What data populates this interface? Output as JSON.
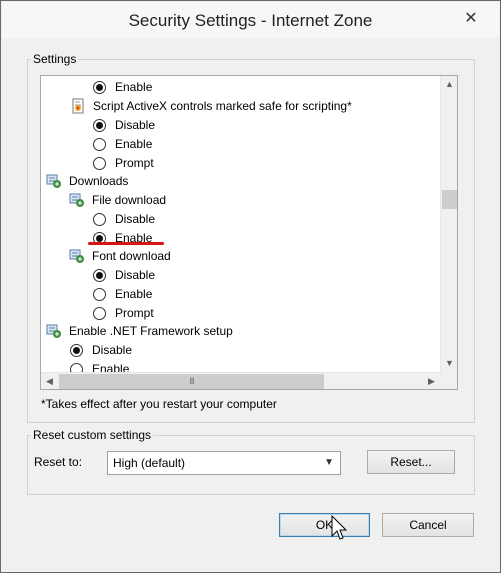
{
  "window": {
    "title": "Security Settings - Internet Zone",
    "close_glyph": "✕"
  },
  "settings_group": {
    "label": "Settings",
    "tree": [
      {
        "kind": "radio",
        "label": "Enable",
        "checked": true
      },
      {
        "kind": "node",
        "icon": "script-activex-icon",
        "label": "Script ActiveX controls marked safe for scripting*"
      },
      {
        "kind": "radio",
        "label": "Disable",
        "checked": true
      },
      {
        "kind": "radio",
        "label": "Enable",
        "checked": false
      },
      {
        "kind": "radio",
        "label": "Prompt",
        "checked": false
      },
      {
        "kind": "node",
        "icon": "settings-category-icon",
        "label": "Downloads"
      },
      {
        "kind": "node",
        "icon": "settings-icon",
        "label": "File download"
      },
      {
        "kind": "radio",
        "label": "Disable",
        "checked": false
      },
      {
        "kind": "radio",
        "label": "Enable",
        "checked": true
      },
      {
        "kind": "node",
        "icon": "settings-icon",
        "label": "Font download"
      },
      {
        "kind": "radio",
        "label": "Disable",
        "checked": true
      },
      {
        "kind": "radio",
        "label": "Enable",
        "checked": false
      },
      {
        "kind": "radio",
        "label": "Prompt",
        "checked": false
      },
      {
        "kind": "node",
        "icon": "settings-icon",
        "label": "Enable .NET Framework setup"
      },
      {
        "kind": "radio",
        "label": "Disable",
        "checked": true
      },
      {
        "kind": "radio",
        "label": "Enable",
        "checked": false
      }
    ],
    "note": "*Takes effect after you restart your computer"
  },
  "reset_group": {
    "label": "Reset custom settings",
    "reset_to_label": "Reset to:",
    "reset_to_value": "High (default)",
    "reset_button": "Reset..."
  },
  "footer": {
    "ok_label": "OK",
    "cancel_label": "Cancel"
  },
  "colors": {
    "highlight_underline": "#d61515",
    "default_button_border": "#3c7fb1"
  }
}
